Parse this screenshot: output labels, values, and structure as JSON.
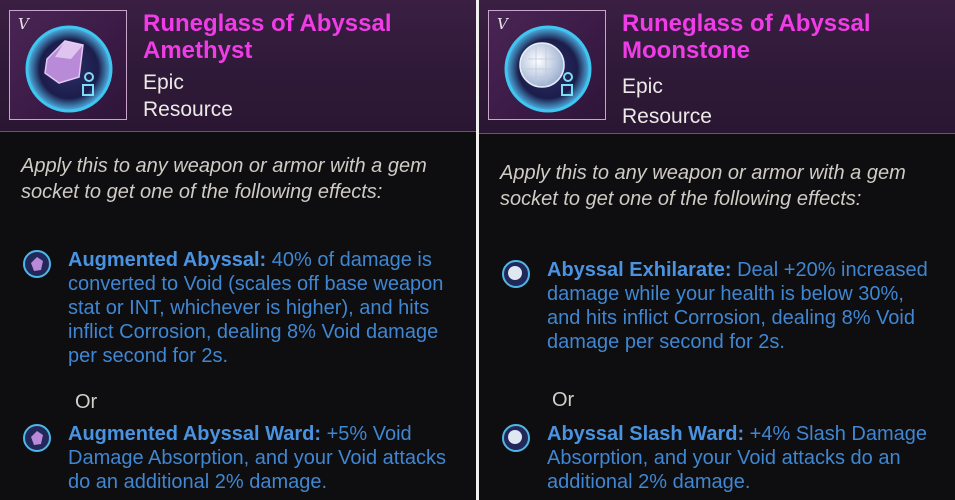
{
  "cards": [
    {
      "rarity_glyph": "V",
      "title_line1": "Runeglass of Abyssal",
      "title_line2": "Amethyst",
      "rarity": "Epic",
      "category": "Resource",
      "gem_color": "#b58ad8",
      "description": "Apply this to any weapon or armor with a gem socket to get one of the following effects:",
      "effects": [
        {
          "name": "Augmented Abyssal:",
          "text": "40% of damage is converted to Void (scales off base weapon stat or INT, whichever is higher), and hits inflict Corrosion, dealing 8% Void damage per second for 2s."
        },
        {
          "name": "Augmented Abyssal Ward:",
          "text": "+5% Void Damage Absorption, and your Void attacks do an additional 2% damage."
        }
      ],
      "or_label": "Or"
    },
    {
      "rarity_glyph": "V",
      "title_line1": "Runeglass of Abyssal",
      "title_line2": "Moonstone",
      "rarity": "Epic",
      "category": "Resource",
      "gem_color": "#d6e0ee",
      "description": "Apply this to any weapon or armor with a gem socket to get one of the following effects:",
      "effects": [
        {
          "name": "Abyssal Exhilarate:",
          "text": "Deal +20% increased damage while your health is below 30%, and hits inflict Corrosion, dealing 8% Void damage per second for 2s."
        },
        {
          "name": "Abyssal Slash Ward:",
          "text": "+4% Slash Damage Absorption, and your Void attacks do an additional 2% damage."
        }
      ],
      "or_label": "Or"
    }
  ],
  "colors": {
    "title": "#f03ce6",
    "effect_text": "#3f87d2",
    "header_bg": "#3a1f42"
  }
}
